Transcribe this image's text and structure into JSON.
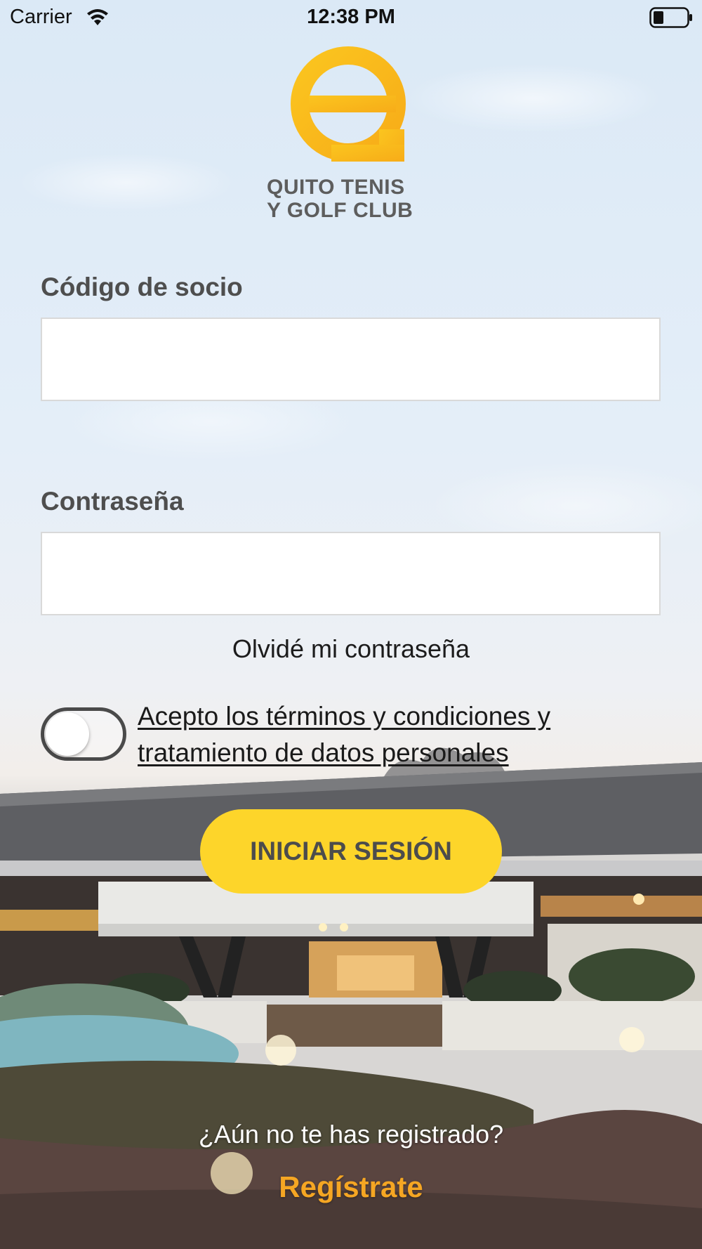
{
  "status_bar": {
    "carrier": "Carrier",
    "time": "12:38 PM",
    "icons": [
      "wifi-icon",
      "battery-icon"
    ]
  },
  "logo": {
    "line1": "QUITO TENIS",
    "line2": "Y GOLF CLUB",
    "color": "#fbbf1f"
  },
  "form": {
    "member_code_label": "Código de socio",
    "member_code_value": "",
    "password_label": "Contraseña",
    "password_value": "",
    "forgot_password": "Olvidé mi contraseña",
    "terms_line1": "Acepto los términos y condiciones y",
    "terms_line2": "tratamiento de datos personales",
    "terms_accepted": false,
    "login_button": "INICIAR SESIÓN"
  },
  "register": {
    "question": "¿Aún no te has registrado?",
    "link": "Regístrate"
  },
  "colors": {
    "button": "#fdd52a",
    "register_link": "#f5a623"
  }
}
